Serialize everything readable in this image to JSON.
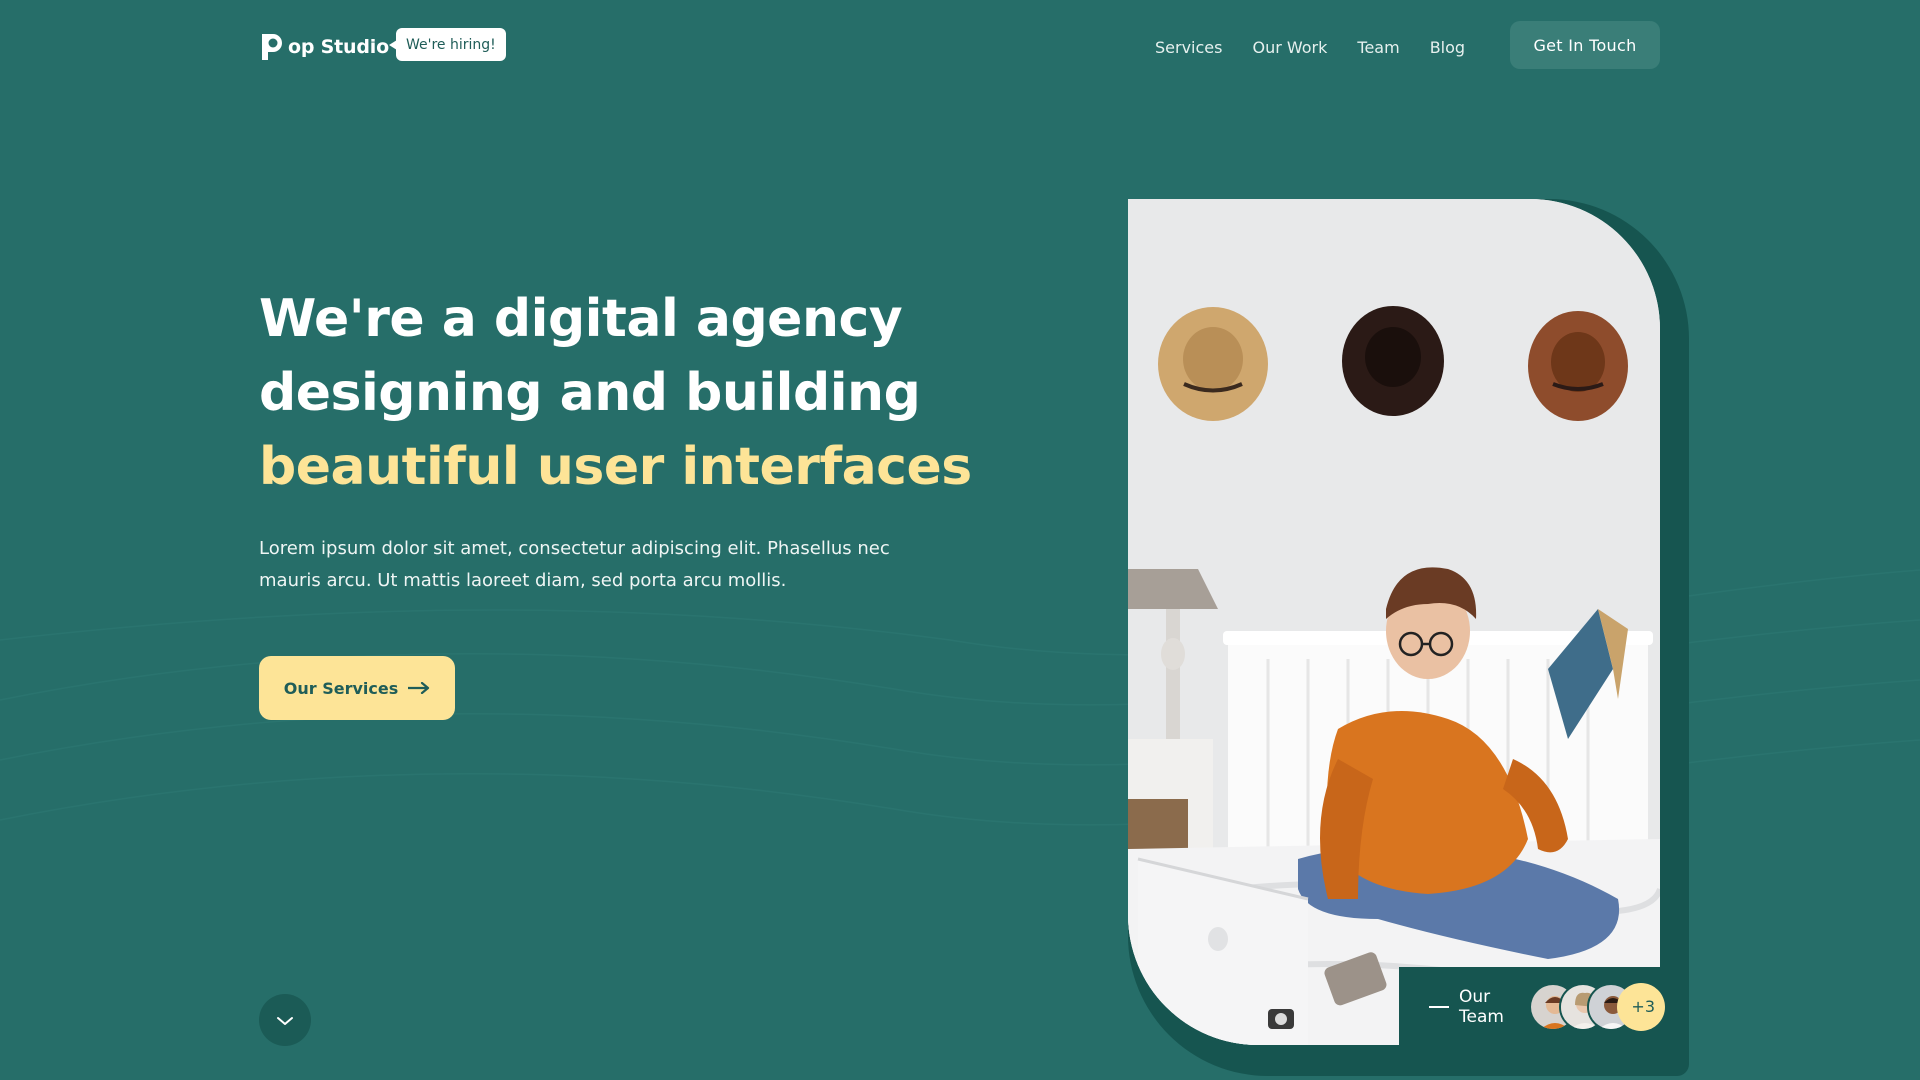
{
  "brand": {
    "logo_letter": "P",
    "name": "op Studio",
    "hiring_badge": "We're hiring!"
  },
  "nav": {
    "items": [
      "Services",
      "Our Work",
      "Team",
      "Blog"
    ],
    "cta": "Get In Touch"
  },
  "hero": {
    "headline_line1": "We're a digital agency",
    "headline_line2": "designing and building",
    "headline_accent": "beautiful user interfaces",
    "lede": "Lorem ipsum dolor sit amet, consectetur adipiscing elit. Phasellus nec mauris arcu. Ut mattis laoreet diam, sed porta arcu mollis.",
    "button_label": "Our Services",
    "button_icon": "arrow-right-icon",
    "scroll_icon": "chevron-down-icon"
  },
  "team": {
    "label_line1": "Our",
    "label_line2": "Team",
    "more_count": "+3"
  },
  "colors": {
    "background": "#266e69",
    "accent": "#fde497",
    "dark_panel": "#165550"
  }
}
